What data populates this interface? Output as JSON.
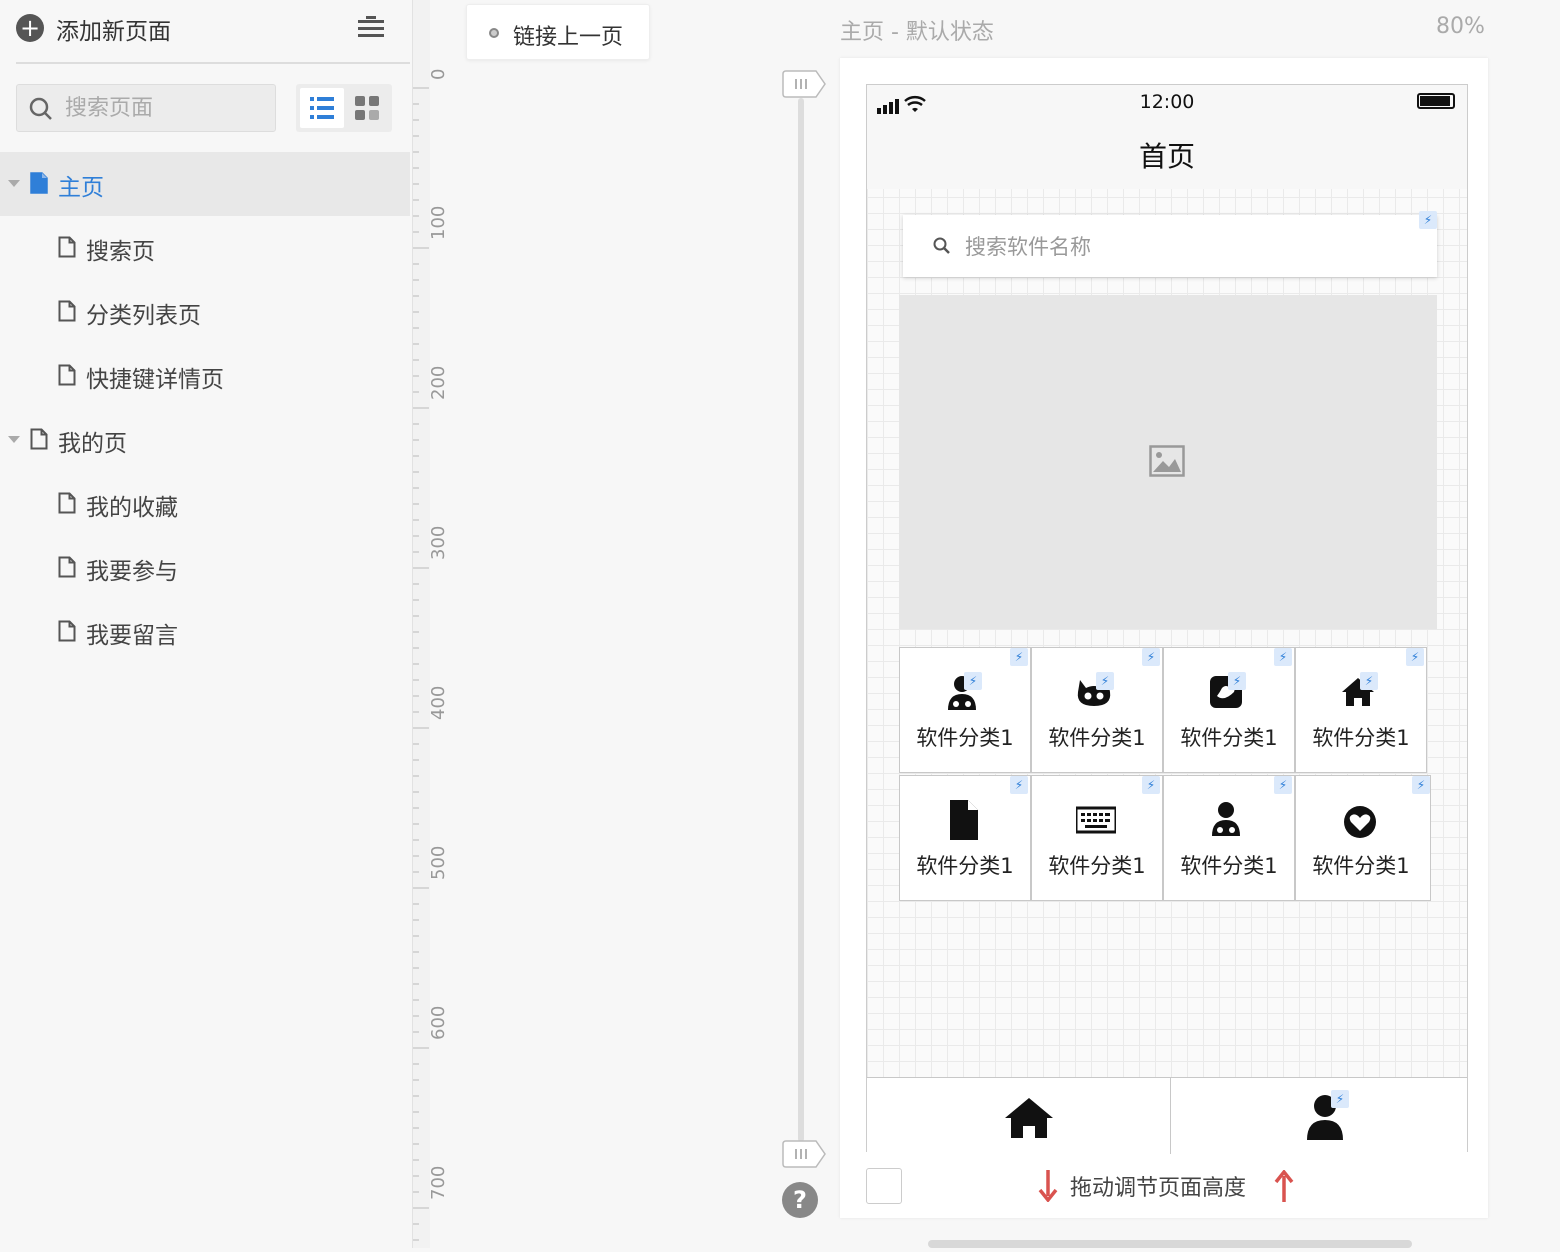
{
  "sidebar": {
    "add_label": "添加新页面",
    "search_placeholder": "搜索页面",
    "pages": [
      {
        "label": "主页",
        "level": 0,
        "active": true
      },
      {
        "label": "搜索页",
        "level": 1
      },
      {
        "label": "分类列表页",
        "level": 1
      },
      {
        "label": "快捷键详情页",
        "level": 1
      },
      {
        "label": "我的页",
        "level": 0
      },
      {
        "label": "我的收藏",
        "level": 1
      },
      {
        "label": "我要参与",
        "level": 1
      },
      {
        "label": "我要留言",
        "level": 1
      }
    ]
  },
  "ruler": {
    "ticks": [
      "0",
      "100",
      "200",
      "300",
      "400",
      "500",
      "600",
      "700"
    ]
  },
  "toolbar": {
    "link_prev_label": "链接上一页"
  },
  "canvas_header": {
    "page_title": "主页 - 默认状态",
    "zoom": "80%"
  },
  "phone": {
    "time": "12:00",
    "nav_title": "首页",
    "search_placeholder": "搜索软件名称",
    "categories": [
      {
        "label": "软件分类1",
        "icon": "user-doctor-icon"
      },
      {
        "label": "软件分类1",
        "icon": "github-cat-icon"
      },
      {
        "label": "软件分类1",
        "icon": "twitter-square-icon"
      },
      {
        "label": "软件分类1",
        "icon": "home-icon"
      },
      {
        "label": "软件分类1",
        "icon": "file-icon"
      },
      {
        "label": "软件分类1",
        "icon": "keyboard-icon"
      },
      {
        "label": "软件分类1",
        "icon": "user-doctor-icon"
      },
      {
        "label": "软件分类1",
        "icon": "heart-circle-icon"
      }
    ]
  },
  "footer": {
    "drag_hint": "拖动调节页面高度"
  },
  "colors": {
    "accent": "#2f7fd8",
    "arrow": "#d9534f"
  }
}
